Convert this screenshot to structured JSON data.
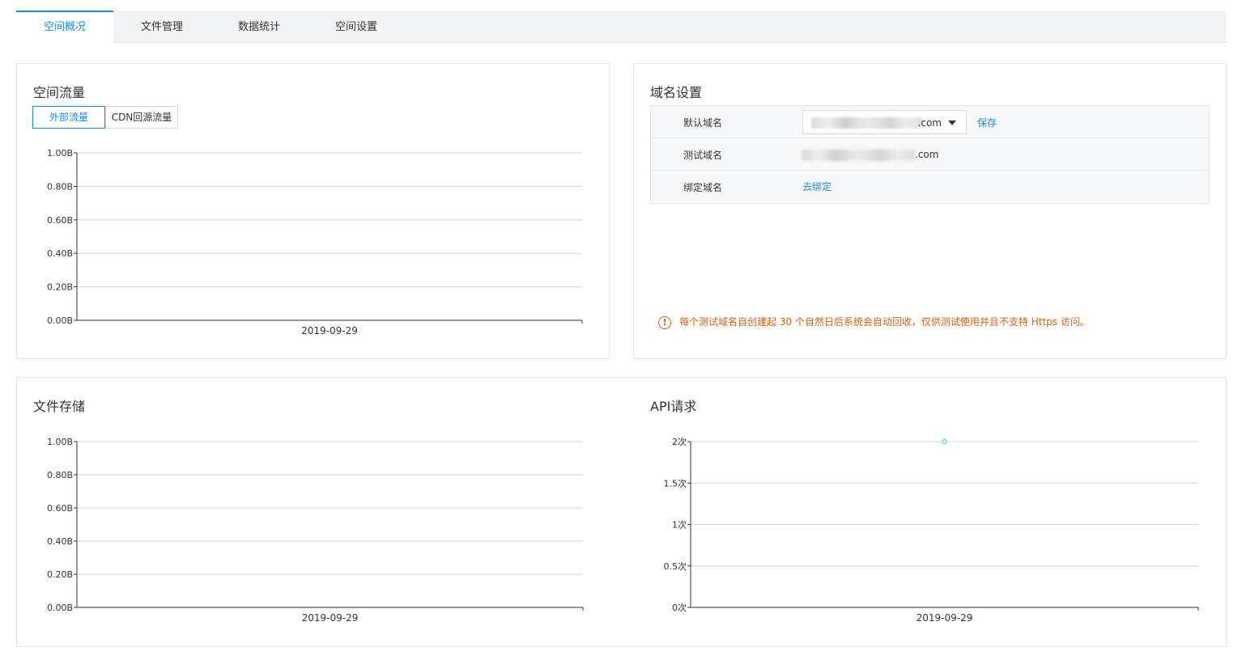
{
  "tabs": [
    {
      "label": "空间概况",
      "active": true
    },
    {
      "label": "文件管理",
      "active": false
    },
    {
      "label": "数据统计",
      "active": false
    },
    {
      "label": "空间设置",
      "active": false
    }
  ],
  "traffic": {
    "title": "空间流量",
    "toggles": [
      {
        "label": "外部流量",
        "active": true
      },
      {
        "label": "CDN回源流量",
        "active": false
      }
    ]
  },
  "domain": {
    "title": "域名设置",
    "rows": {
      "default": {
        "label": "默认域名",
        "suffix": ".com",
        "save": "保存"
      },
      "test": {
        "label": "测试域名",
        "suffix": ".com"
      },
      "bind": {
        "label": "绑定域名",
        "action": "去绑定"
      }
    },
    "warning": "每个测试域名自创建起 30 个自然日后系统会自动回收，仅供测试使用并且不支持 Https 访问。",
    "warning_icon": "exclamation-circle-icon"
  },
  "storage": {
    "title": "文件存储"
  },
  "api": {
    "title": "API请求"
  },
  "colors": {
    "accent": "#1e88e5",
    "warning": "#e05d12",
    "api_point": "#3cc9a6"
  },
  "chart_data": [
    {
      "id": "traffic",
      "type": "line",
      "title": "空间流量",
      "x": [
        "2019-09-29"
      ],
      "ylim": [
        0,
        1
      ],
      "yticks": [
        "0.00B",
        "0.20B",
        "0.40B",
        "0.60B",
        "0.80B",
        "1.00B"
      ],
      "series": [
        {
          "values": [
            0
          ]
        }
      ],
      "grid": true
    },
    {
      "id": "storage",
      "type": "line",
      "title": "文件存储",
      "x": [
        "2019-09-29"
      ],
      "ylim": [
        0,
        1
      ],
      "yticks": [
        "0.00B",
        "0.20B",
        "0.40B",
        "0.60B",
        "0.80B",
        "1.00B"
      ],
      "series": [
        {
          "values": [
            0
          ]
        }
      ],
      "grid": true
    },
    {
      "id": "api",
      "type": "line",
      "title": "API请求",
      "x": [
        "2019-09-29"
      ],
      "ylim": [
        0,
        2
      ],
      "yticks": [
        "0次",
        "0.5次",
        "1次",
        "1.5次",
        "2次"
      ],
      "series": [
        {
          "values": [
            2
          ]
        }
      ],
      "grid": true
    }
  ]
}
